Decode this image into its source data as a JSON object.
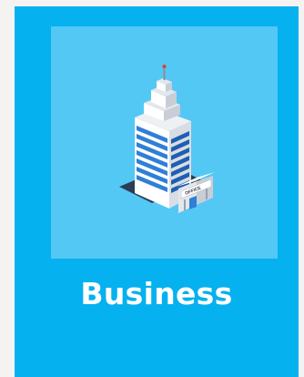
{
  "card": {
    "title": "Business",
    "icon": "office-building-icon",
    "building_sign": "OFFICE"
  },
  "colors": {
    "page_background": "#f5f3f1",
    "card_background": "#05b1ee",
    "image_background": "#54c8f4",
    "title_text": "#ffffff"
  }
}
